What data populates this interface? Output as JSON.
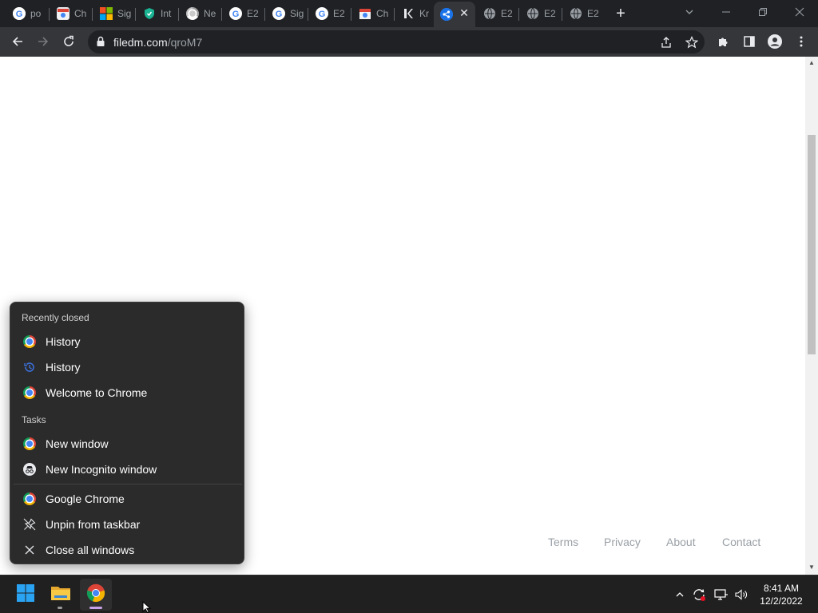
{
  "browser": {
    "tabs": [
      {
        "label": "po",
        "icon": "google-icon"
      },
      {
        "label": "Ch",
        "icon": "chrome-store-icon"
      },
      {
        "label": "Sig",
        "icon": "microsoft-icon"
      },
      {
        "label": "Int",
        "icon": "shield-icon"
      },
      {
        "label": "Ne",
        "icon": "chrome-icon"
      },
      {
        "label": "E2",
        "icon": "google-icon"
      },
      {
        "label": "Sig",
        "icon": "google-icon"
      },
      {
        "label": "E2",
        "icon": "google-icon"
      },
      {
        "label": "Ch",
        "icon": "chrome-store-icon"
      },
      {
        "label": "Kr",
        "icon": "kr-icon"
      },
      {
        "label": "",
        "icon": "share-icon",
        "active": true
      },
      {
        "label": "E2",
        "icon": "globe-icon"
      },
      {
        "label": "E2",
        "icon": "globe-icon"
      },
      {
        "label": "E2",
        "icon": "globe-icon"
      }
    ],
    "new_tab_label": "+",
    "url_host": "filedm.com",
    "url_path": "/qroM7"
  },
  "page": {
    "footer_links": [
      "Terms",
      "Privacy",
      "About",
      "Contact"
    ]
  },
  "jumplist": {
    "recent_heading": "Recently closed",
    "recent_items": [
      {
        "label": "History",
        "icon": "chrome-icon"
      },
      {
        "label": "History",
        "icon": "history-icon"
      },
      {
        "label": "Welcome to Chrome",
        "icon": "chrome-icon"
      }
    ],
    "tasks_heading": "Tasks",
    "task_items": [
      {
        "label": "New window",
        "icon": "chrome-icon"
      },
      {
        "label": "New Incognito window",
        "icon": "incognito-icon"
      }
    ],
    "app_items": [
      {
        "label": "Google Chrome",
        "icon": "chrome-icon"
      },
      {
        "label": "Unpin from taskbar",
        "icon": "unpin-icon"
      },
      {
        "label": "Close all windows",
        "icon": "close-icon"
      }
    ]
  },
  "taskbar": {
    "time": "8:41 AM",
    "date": "12/2/2022"
  }
}
